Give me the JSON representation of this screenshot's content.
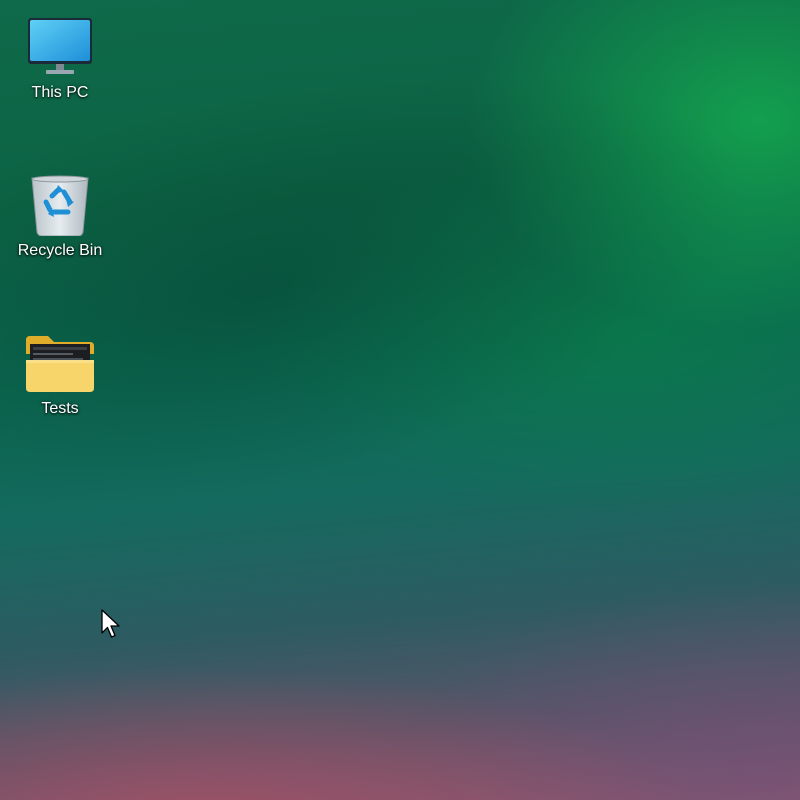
{
  "desktop": {
    "icons": [
      {
        "label": "This PC",
        "icon": "monitor-icon"
      },
      {
        "label": "Recycle Bin",
        "icon": "recycle-bin-icon"
      },
      {
        "label": "Tests",
        "icon": "folder-icon"
      }
    ]
  },
  "cursor": {
    "icon": "mouse-pointer-icon"
  },
  "colors": {
    "wallpaper_green": "#0c6344",
    "wallpaper_bright_green": "#14aa50",
    "wallpaper_pink": "#8a5670",
    "label_text": "#ffffff",
    "folder_yellow": "#f7d56a"
  }
}
